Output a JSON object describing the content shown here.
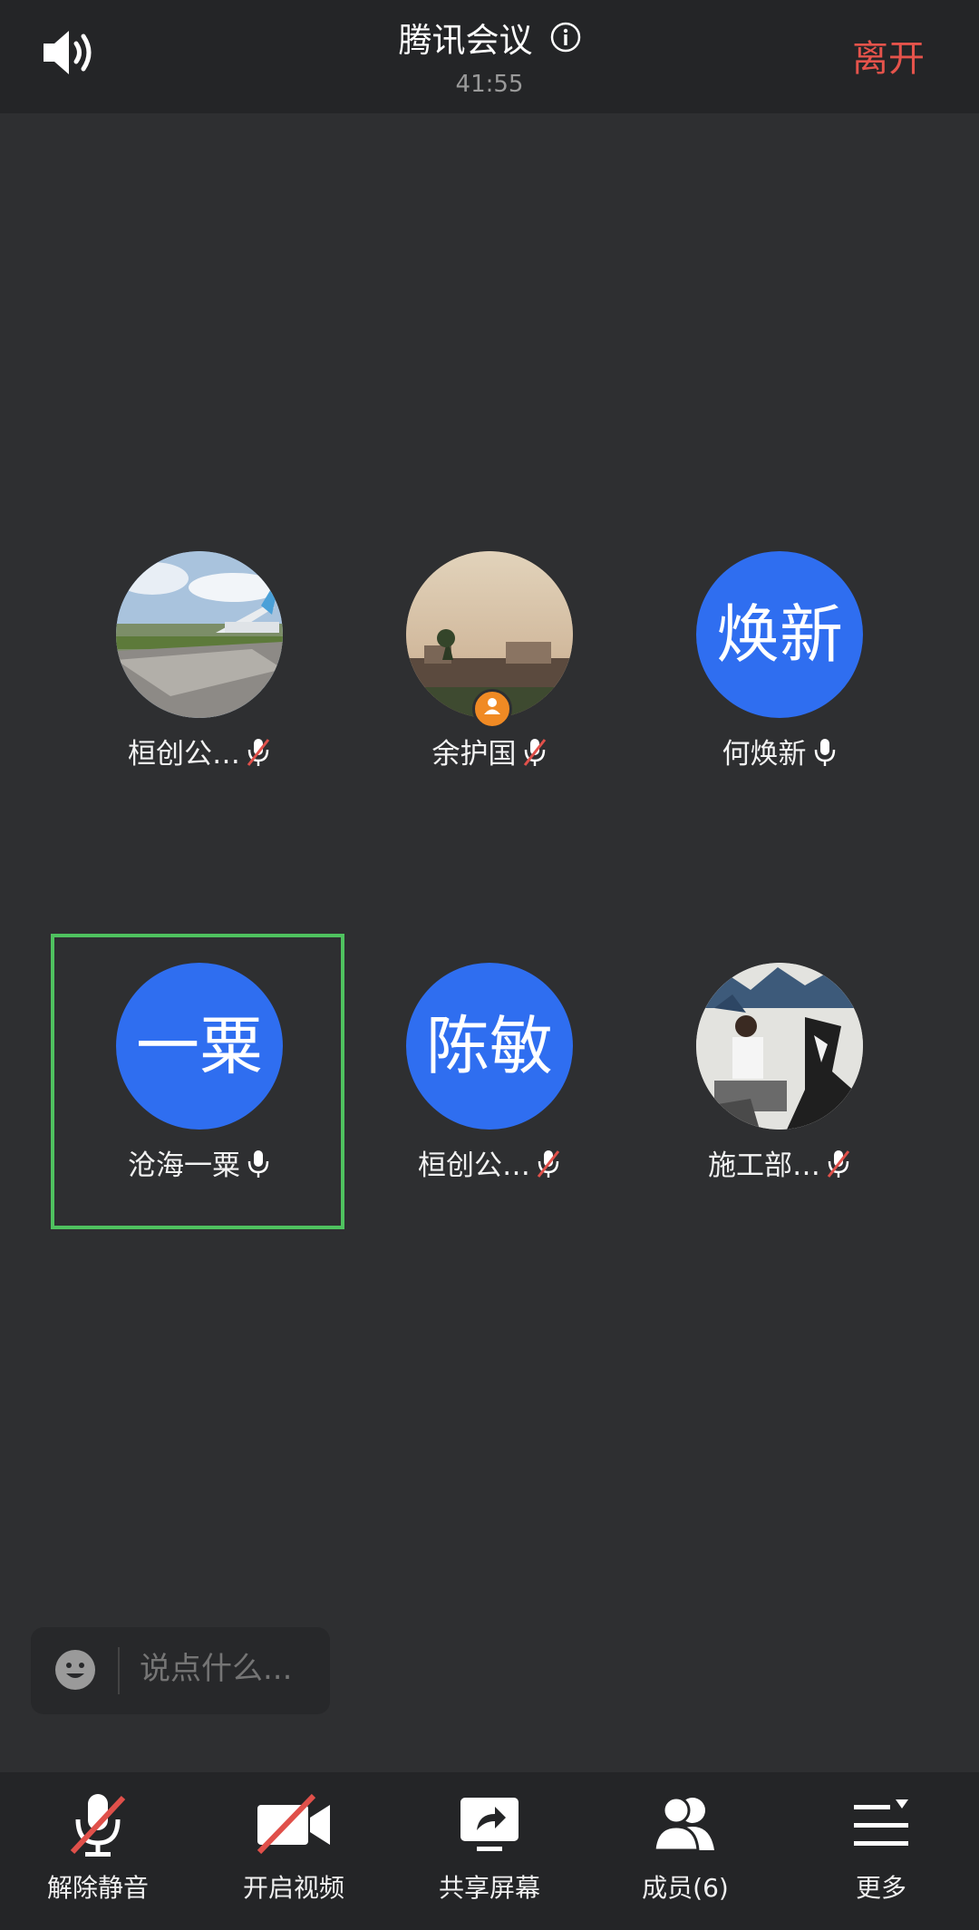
{
  "header": {
    "title": "腾讯会议",
    "timer": "41:55",
    "leave_label": "离开"
  },
  "participants": [
    {
      "name": "桓创公…",
      "avatar_type": "photo-airplane",
      "mic": "muted"
    },
    {
      "name": "余护国",
      "avatar_type": "photo-sunset",
      "mic": "muted",
      "host": true
    },
    {
      "name": "何焕新",
      "avatar_text": "焕新",
      "mic": "on"
    },
    {
      "name": "沧海一粟",
      "avatar_text": "一粟",
      "mic": "on",
      "active": true
    },
    {
      "name": "桓创公…",
      "avatar_text": "陈敏",
      "mic": "muted"
    },
    {
      "name": "施工部…",
      "avatar_type": "photo-painting",
      "mic": "muted"
    }
  ],
  "chat": {
    "placeholder": "说点什么..."
  },
  "toolbar": {
    "unmute_label": "解除静音",
    "video_label": "开启视频",
    "share_label": "共享屏幕",
    "members_label": "成员(6)",
    "more_label": "更多"
  },
  "colors": {
    "accent_blue": "#2f6ef0",
    "leave_red": "#e5534b",
    "active_green": "#4fc25f",
    "mute_red": "#e0504a"
  },
  "icons": [
    "speaker-icon",
    "info-icon",
    "mic-muted-icon",
    "mic-icon",
    "host-badge-icon",
    "emoji-icon",
    "video-off-icon",
    "share-screen-icon",
    "members-icon",
    "more-icon"
  ]
}
